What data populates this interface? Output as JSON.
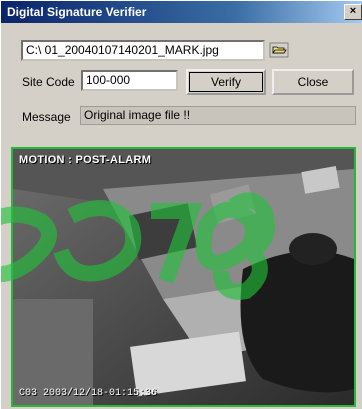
{
  "window": {
    "title": "Digital Signature Verifier",
    "close_glyph": "×"
  },
  "file": {
    "path": "C:\\ 01_20040107140201_MARK.jpg",
    "browse_icon": "open-folder-icon"
  },
  "site_code": {
    "label": "Site Code",
    "value": "100-000"
  },
  "buttons": {
    "verify": "Verify",
    "close": "Close"
  },
  "message": {
    "label": "Message",
    "text": "Original image file !!"
  },
  "image": {
    "overlay_top": "MOTION : POST-ALARM",
    "overlay_bottom": "C03 2003/12/18-01:15:36",
    "frame_color": "#27b83a"
  },
  "colors": {
    "watermark": "#22c23a",
    "title_bar": "#0a246a"
  }
}
